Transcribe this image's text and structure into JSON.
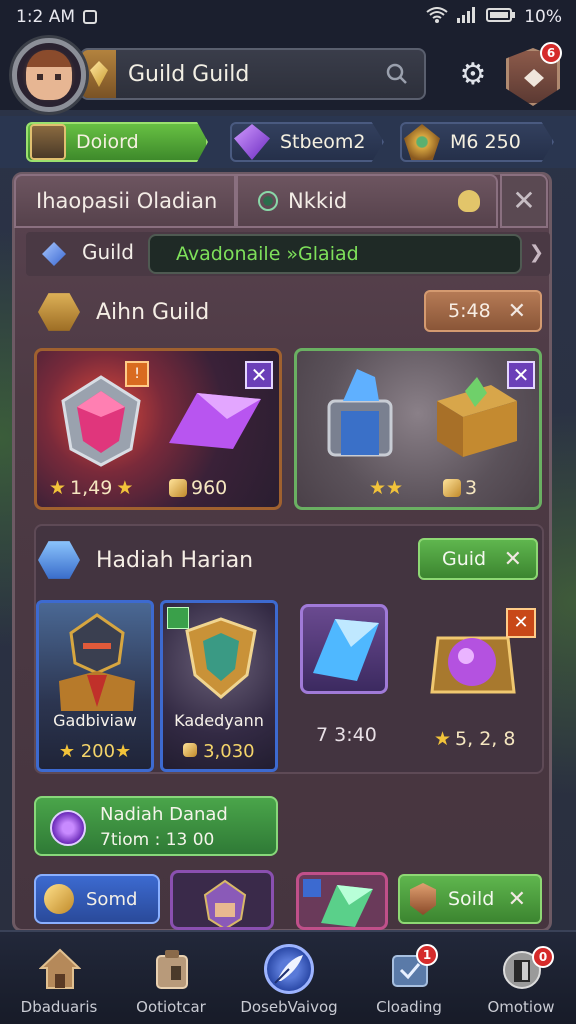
{
  "status": {
    "time": "1:2 AM",
    "battery": "10%"
  },
  "header": {
    "title": "Guild  Guild",
    "notification_count": "6"
  },
  "currencies": [
    {
      "label": "Doiord"
    },
    {
      "label": "Stbeom2"
    },
    {
      "label": "M6 250"
    }
  ],
  "tabs": [
    {
      "label": "Ihaopasii  Oladian"
    },
    {
      "label": "Nkkid"
    }
  ],
  "guild_field": {
    "label": "Guild",
    "value": "Avadonaile »Glaiad"
  },
  "section1": {
    "title": "Aihn Guild",
    "timer": "5:48"
  },
  "cards": [
    {
      "stat_a": "1,49",
      "stat_b": "960",
      "badge": "!"
    },
    {
      "stat": "3"
    }
  ],
  "section2": {
    "title": "Hadiah Harian",
    "button": "Guid"
  },
  "heroes": [
    {
      "name": "Gadbiviaw",
      "value": "200"
    },
    {
      "name": "Kadedyann",
      "value": "3,030"
    }
  ],
  "items": [
    {
      "value": "7 3:40"
    },
    {
      "value": "5, 2, 8"
    }
  ],
  "promo": {
    "title": "Nadiah Danad",
    "subtitle": "7tiom : 13 00"
  },
  "bottom": {
    "somd": "Somd",
    "soild": "Soild"
  },
  "nav": [
    {
      "label": "Dbaduaris",
      "badge": ""
    },
    {
      "label": "Ootiotcar",
      "badge": ""
    },
    {
      "label": "DosebVaivog",
      "badge": ""
    },
    {
      "label": "Cloading",
      "badge": "1"
    },
    {
      "label": "Omotiow",
      "badge": "0"
    }
  ],
  "colors": {
    "accent_green": "#5fb64e",
    "panel": "#4d3a44",
    "bronze": "#b57a55"
  }
}
